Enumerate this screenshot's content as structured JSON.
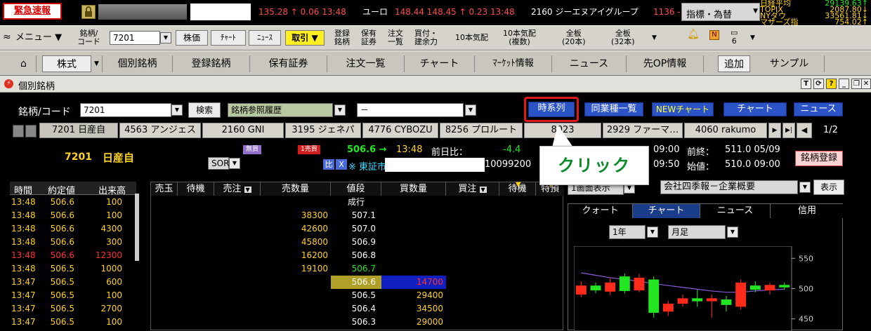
{
  "ticker": {
    "emergency_label": "緊急速報",
    "items": [
      {
        "text": "135.28 ↑ 0.06 13:48",
        "color": "#ff4a4a"
      },
      {
        "text": "ユーロ",
        "color": "#ffffff"
      },
      {
        "text": "148.44 148.45 ↑ 0.23 13:48",
        "color": "#ff4a4a"
      },
      {
        "text": "2160 ジーエヌアイグループ",
        "color": "#ffffff"
      },
      {
        "text": "1136 -",
        "color": "#ff4a4a"
      }
    ],
    "indicator_select": "指標・為替"
  },
  "indices": [
    {
      "name": "日経平均",
      "value": "29139.63↑"
    },
    {
      "name": "TOPIX",
      "value": "2087.80↓"
    },
    {
      "name": "NYダウ",
      "value": "33561.81↓"
    },
    {
      "name": "マザーズ指",
      "value": "754.02↑"
    }
  ],
  "toolbar": {
    "menu_label": "メニュー",
    "code_label_1": "銘柄/",
    "code_label_2": "コード",
    "code_value": "7201",
    "stock_price": "株価",
    "chart": "ﾁｬｰﾄ",
    "news": "ﾆｭｰｽ",
    "trade": "取引",
    "reg_1": "登録",
    "reg_2": "銘柄",
    "hold_1": "保有",
    "hold_2": "証券",
    "order_1": "注文",
    "order_2": "一覧",
    "buysell_1": "買付・",
    "buysell_2": "建余力",
    "ten_quote": "10本気配",
    "ten_multi_1": "10本気配",
    "ten_multi_2": "(複数)",
    "full20_1": "全板",
    "full20_2": "(20本)",
    "full32_1": "全板",
    "full32_2": "(32本)",
    "page_num": "6"
  },
  "navbar": {
    "stocks": "株式",
    "items": [
      "個別銘柄",
      "登録銘柄",
      "保有証券",
      "注文一覧",
      "チャート",
      "ﾏｰｹｯﾄ情報",
      "ニュース",
      "先OP情報"
    ],
    "add": "追加",
    "sample": "サンプル"
  },
  "window": {
    "title": "個別銘柄",
    "code_label": "銘柄/コード",
    "code_value": "7201",
    "search": "検索",
    "ref_history": "銘柄参照履歴",
    "select2": "－",
    "btn_timeseries": "時系列",
    "btn_same_industry": "同業種一覧",
    "btn_new_chart": "NEWチャート",
    "btn_chart": "チャート",
    "btn_news": "ニュース",
    "history_tabs": [
      "7201 日産自",
      "4563 アンジェス",
      "2160 GNI",
      "3195 ジェネパ",
      "4776 CYBOZU",
      "8256 プロルート",
      "8023 ",
      "2929 ファーマ…",
      "4060 rakumo"
    ],
    "page_indicator": "1/2"
  },
  "quote": {
    "code": "7201",
    "name": "日産自",
    "badge_free": "無買",
    "badge_one": "1売買",
    "price": "506.6 →",
    "time": "13:48",
    "prev_diff_label": "前日比：",
    "prev_diff": "-4.4",
    "market_select": "SOR",
    "market_tag_1": "比",
    "market_tag_2": "X",
    "market": "※ 東証市",
    "volume": "10099200",
    "t1": "09:00",
    "prev_close_label": "前終：",
    "prev_close": "511.0 05/09",
    "t2": "09:50",
    "open_label": "始値：",
    "open": "510.0 09:00",
    "register_btn": "銘柄登録"
  },
  "callout": "クリック",
  "timesales": {
    "headers": [
      "時間",
      "約定値",
      "出来高"
    ],
    "rows": [
      {
        "time": "13:48",
        "price": "506.6",
        "vol": "100",
        "hl": false
      },
      {
        "time": "13:48",
        "price": "506.6",
        "vol": "100",
        "hl": false
      },
      {
        "time": "13:48",
        "price": "506.6",
        "vol": "4300",
        "hl": false
      },
      {
        "time": "13:48",
        "price": "506.6",
        "vol": "300",
        "hl": false
      },
      {
        "time": "13:48",
        "price": "506.6",
        "vol": "12300",
        "hl": true
      },
      {
        "time": "13:48",
        "price": "506.5",
        "vol": "1000",
        "hl": false
      },
      {
        "time": "13:47",
        "price": "506.5",
        "vol": "600",
        "hl": false
      },
      {
        "time": "13:47",
        "price": "506.5",
        "vol": "100",
        "hl": false
      },
      {
        "time": "13:47",
        "price": "506.5",
        "vol": "2700",
        "hl": false
      },
      {
        "time": "13:47",
        "price": "506.5",
        "vol": "100",
        "hl": false
      }
    ]
  },
  "board": {
    "headers": [
      "売玉",
      "待機",
      "売注",
      "売数量",
      "値段",
      "買数量",
      "買注",
      "待機",
      "特預"
    ],
    "market_order": "成行",
    "rows": [
      {
        "sell": "38300",
        "price": "507.1",
        "buy": ""
      },
      {
        "sell": "42600",
        "price": "507.0",
        "buy": ""
      },
      {
        "sell": "45800",
        "price": "506.9",
        "buy": ""
      },
      {
        "sell": "16200",
        "price": "506.8",
        "buy": ""
      },
      {
        "sell": "19100",
        "price": "506.7",
        "buy": ""
      },
      {
        "sell": "",
        "price": "506.6",
        "buy": "14700"
      },
      {
        "sell": "",
        "price": "506.5",
        "buy": "29400"
      },
      {
        "sell": "",
        "price": "506.4",
        "buy": "34500"
      },
      {
        "sell": "",
        "price": "506.3",
        "buy": "29000"
      }
    ]
  },
  "right": {
    "view_select": "1画面表示",
    "info_select": "会社四季報－企業概要",
    "show_btn": "表示",
    "tabs": [
      "クォート",
      "チャート",
      "ニュース",
      "信用"
    ],
    "period": "1年",
    "interval": "月足"
  },
  "chart_data": {
    "type": "candlestick",
    "y_ticks": [
      "550",
      "500",
      "450"
    ],
    "ylim": [
      430,
      570
    ],
    "candles": [
      {
        "o": 490,
        "c": 505,
        "h": 512,
        "l": 486
      },
      {
        "o": 505,
        "c": 497,
        "h": 510,
        "l": 492
      },
      {
        "o": 495,
        "c": 510,
        "h": 518,
        "l": 489
      },
      {
        "o": 520,
        "c": 496,
        "h": 525,
        "l": 492
      },
      {
        "o": 497,
        "c": 518,
        "h": 524,
        "l": 494
      },
      {
        "o": 515,
        "c": 460,
        "h": 520,
        "l": 452
      },
      {
        "o": 462,
        "c": 475,
        "h": 480,
        "l": 455
      },
      {
        "o": 475,
        "c": 484,
        "h": 490,
        "l": 470
      },
      {
        "o": 484,
        "c": 479,
        "h": 498,
        "l": 470
      },
      {
        "o": 479,
        "c": 484,
        "h": 490,
        "l": 452
      },
      {
        "o": 482,
        "c": 473,
        "h": 488,
        "l": 462
      },
      {
        "o": 470,
        "c": 510,
        "h": 515,
        "l": 465
      },
      {
        "o": 505,
        "c": 498,
        "h": 512,
        "l": 494
      },
      {
        "o": 497,
        "c": 506,
        "h": 510,
        "l": 490
      },
      {
        "o": 506,
        "c": 502,
        "h": 510,
        "l": 498
      }
    ],
    "ma": [
      526,
      522,
      518,
      515,
      512,
      508,
      505,
      502,
      499,
      496,
      494,
      494,
      496,
      498,
      499
    ]
  }
}
